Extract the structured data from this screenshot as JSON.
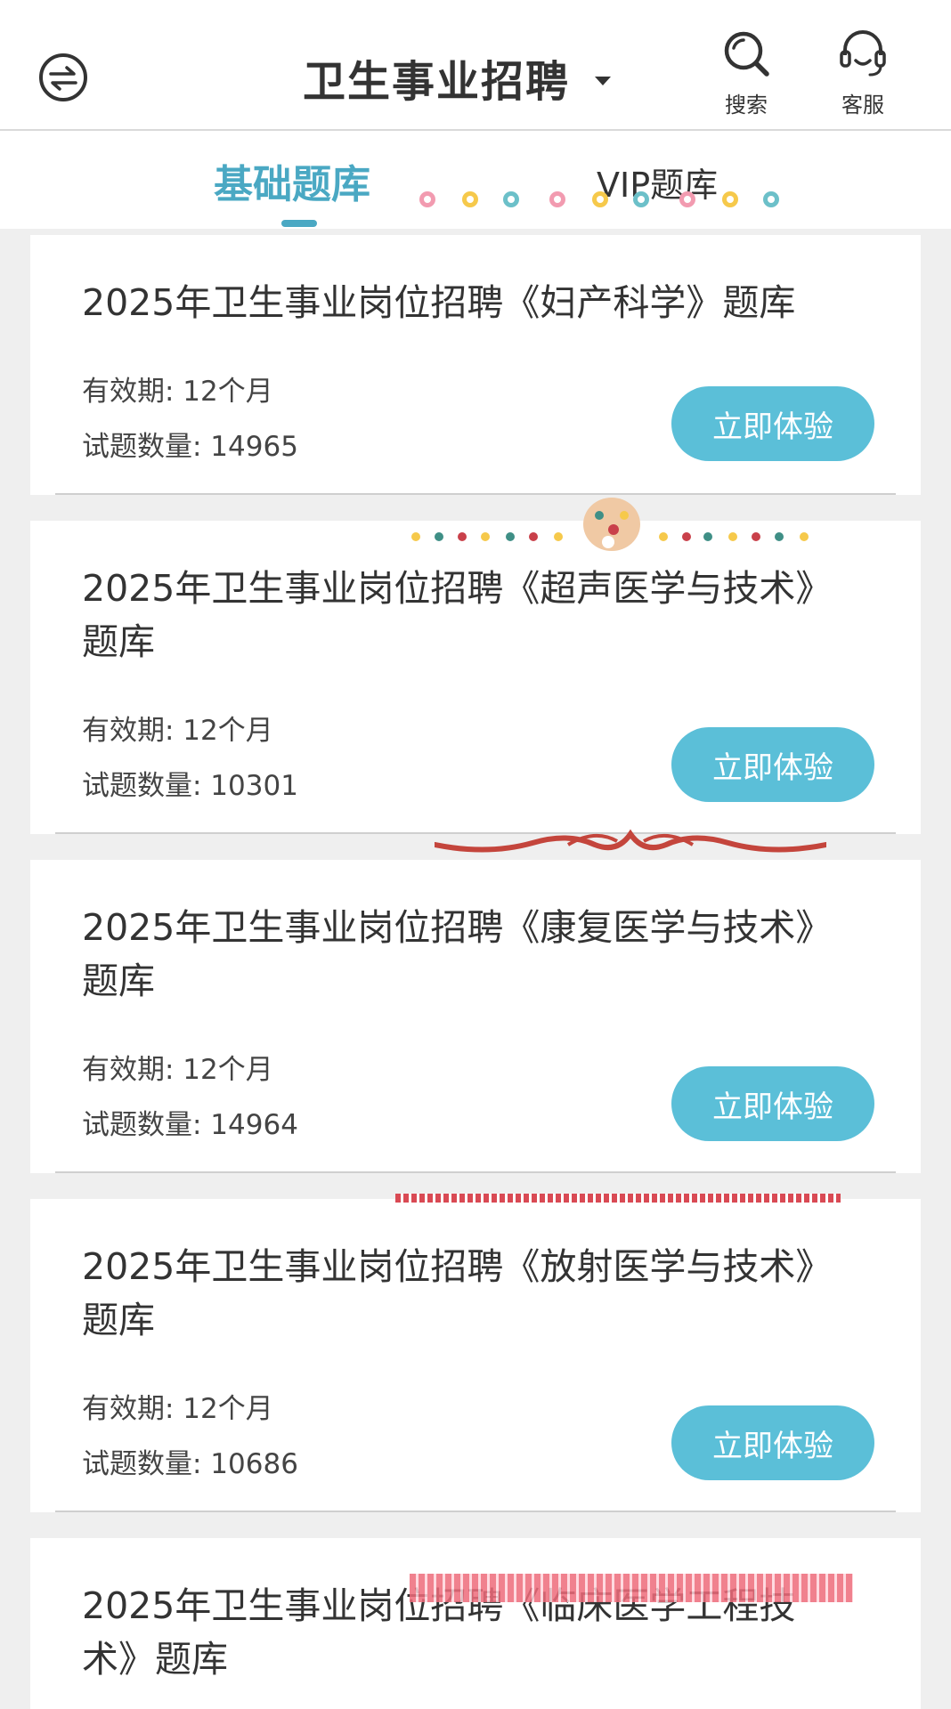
{
  "header": {
    "title": "卫生事业招聘",
    "search_label": "搜索",
    "service_label": "客服"
  },
  "tabs": {
    "basic": "基础题库",
    "vip": "VIP题库"
  },
  "colors": {
    "accent": "#4aa8c3",
    "button": "#5bbfd8",
    "background": "#efefef"
  },
  "cards": [
    {
      "title": "2025年卫生事业岗位招聘《妇产科学》题库",
      "validity": "有效期: 12个月",
      "count": "试题数量: 14965",
      "button": "立即体验"
    },
    {
      "title": "2025年卫生事业岗位招聘《超声医学与技术》题库",
      "validity": "有效期: 12个月",
      "count": "试题数量: 10301",
      "button": "立即体验"
    },
    {
      "title": "2025年卫生事业岗位招聘《康复医学与技术》题库",
      "validity": "有效期: 12个月",
      "count": "试题数量: 14964",
      "button": "立即体验"
    },
    {
      "title": "2025年卫生事业岗位招聘《放射医学与技术》题库",
      "validity": "有效期: 12个月",
      "count": "试题数量: 10686",
      "button": "立即体验"
    },
    {
      "title": "2025年卫生事业岗位招聘《临床医学工程技术》题库"
    }
  ]
}
